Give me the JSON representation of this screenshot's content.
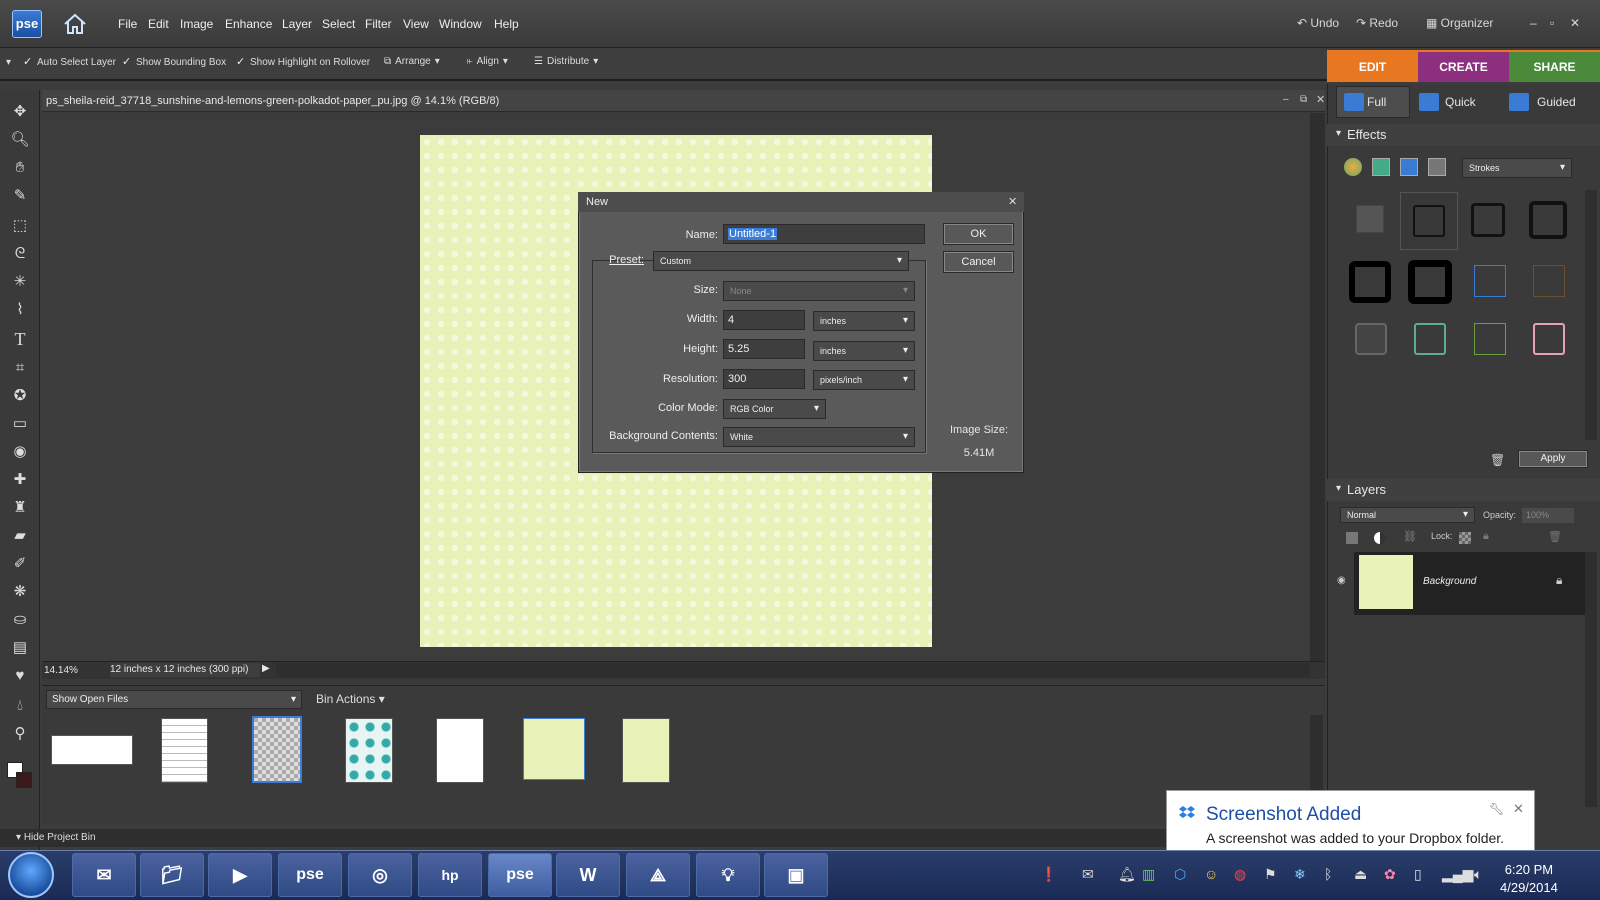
{
  "menubar": {
    "logo": "pse",
    "items": [
      "File",
      "Edit",
      "Image",
      "Enhance",
      "Layer",
      "Select",
      "Filter",
      "View",
      "Window",
      "Help"
    ],
    "undo": "Undo",
    "redo": "Redo",
    "organizer": "Organizer"
  },
  "options": {
    "auto_select": "Auto Select Layer",
    "bounding_box": "Show Bounding Box",
    "highlight": "Show Highlight on Rollover",
    "arrange": "Arrange",
    "align": "Align",
    "distribute": "Distribute"
  },
  "modes": {
    "edit": "EDIT",
    "create": "CREATE",
    "share": "SHARE"
  },
  "doc": {
    "title": "ps_sheila-reid_37718_sunshine-and-lemons-green-polkadot-paper_pu.jpg @ 14.1% (RGB/8)",
    "zoom": "14.14%",
    "size": "12 inches x 12 inches (300 ppi)"
  },
  "bin": {
    "select": "Show Open Files",
    "actions": "Bin Actions",
    "hide": "Hide Project Bin"
  },
  "panel": {
    "views": [
      "Full",
      "Quick",
      "Guided"
    ],
    "effects": "Effects",
    "strokes": "Strokes",
    "apply": "Apply",
    "layers": "Layers",
    "blend": "Normal",
    "opacity": "Opacity:",
    "opacity_val": "100%",
    "lock": "Lock:",
    "layer_name": "Background"
  },
  "dialog": {
    "title": "New",
    "name_label": "Name:",
    "name_value": "Untitled-1",
    "preset_label": "Preset:",
    "preset_value": "Custom",
    "size_label": "Size:",
    "size_value": "None",
    "width_label": "Width:",
    "width_value": "4",
    "width_unit": "inches",
    "height_label": "Height:",
    "height_value": "5.25",
    "height_unit": "inches",
    "res_label": "Resolution:",
    "res_value": "300",
    "res_unit": "pixels/inch",
    "mode_label": "Color Mode:",
    "mode_value": "RGB Color",
    "bg_label": "Background Contents:",
    "bg_value": "White",
    "ok": "OK",
    "cancel": "Cancel",
    "imgsize_label": "Image Size:",
    "imgsize_value": "5.41M"
  },
  "toast": {
    "title": "Screenshot Added",
    "body": "A screenshot was added to your Dropbox folder."
  },
  "clock": {
    "time": "6:20 PM",
    "date": "4/29/2014"
  },
  "colors": {
    "edit": "#e87722",
    "create": "#8c2f7e",
    "share": "#4a8a3a",
    "accent": "#1e6fd6"
  }
}
